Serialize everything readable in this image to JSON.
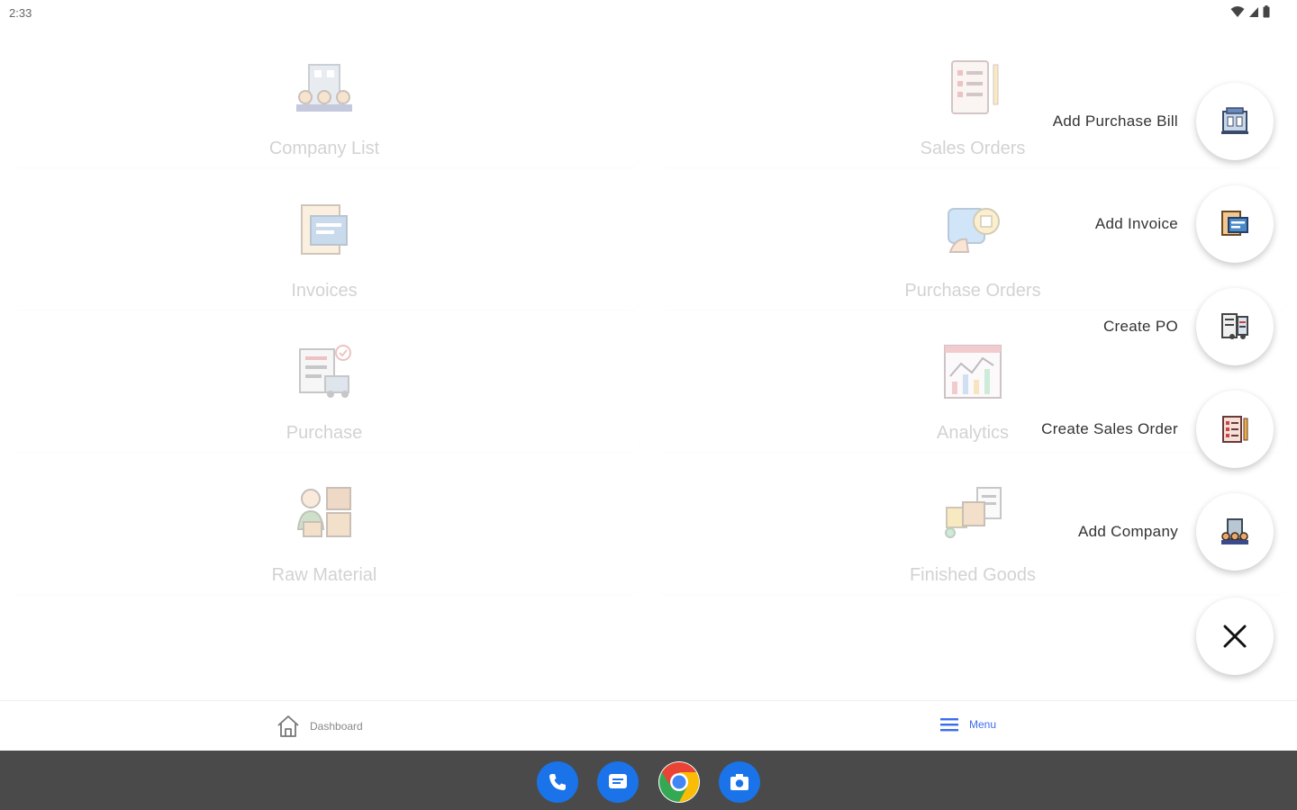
{
  "status_bar": {
    "time": "2:33"
  },
  "cards": [
    {
      "label": "Company List",
      "icon": "company-list-icon"
    },
    {
      "label": "Sales Orders",
      "icon": "sales-orders-icon"
    },
    {
      "label": "Invoices",
      "icon": "invoices-icon"
    },
    {
      "label": "Purchase Orders",
      "icon": "purchase-orders-icon"
    },
    {
      "label": "Purchase",
      "icon": "purchase-icon"
    },
    {
      "label": "Analytics",
      "icon": "analytics-icon"
    },
    {
      "label": "Raw Material",
      "icon": "raw-material-icon"
    },
    {
      "label": "Finished Goods",
      "icon": "finished-goods-icon"
    }
  ],
  "fab_menu": {
    "items": [
      {
        "label": "Add Purchase Bill",
        "icon": "purchase-bill-icon"
      },
      {
        "label": "Add Invoice",
        "icon": "invoice-icon"
      },
      {
        "label": "Create PO",
        "icon": "purchase-order-icon"
      },
      {
        "label": "Create Sales Order",
        "icon": "sales-order-icon"
      },
      {
        "label": "Add Company",
        "icon": "company-icon"
      }
    ],
    "close_icon": "close-icon"
  },
  "bottom_nav": {
    "items": [
      {
        "label": "Dashboard",
        "icon": "home-icon",
        "active": false
      },
      {
        "label": "Menu",
        "icon": "menu-icon",
        "active": true
      }
    ]
  },
  "taskbar": {
    "apps": [
      {
        "name": "phone",
        "icon": "phone-icon"
      },
      {
        "name": "messages",
        "icon": "messages-icon"
      },
      {
        "name": "chrome",
        "icon": "chrome-icon"
      },
      {
        "name": "camera",
        "icon": "camera-icon"
      }
    ]
  },
  "colors": {
    "accent": "#3b6cf0",
    "taskbar": "#4a4a4a",
    "dock_blue": "#1a73e8"
  }
}
